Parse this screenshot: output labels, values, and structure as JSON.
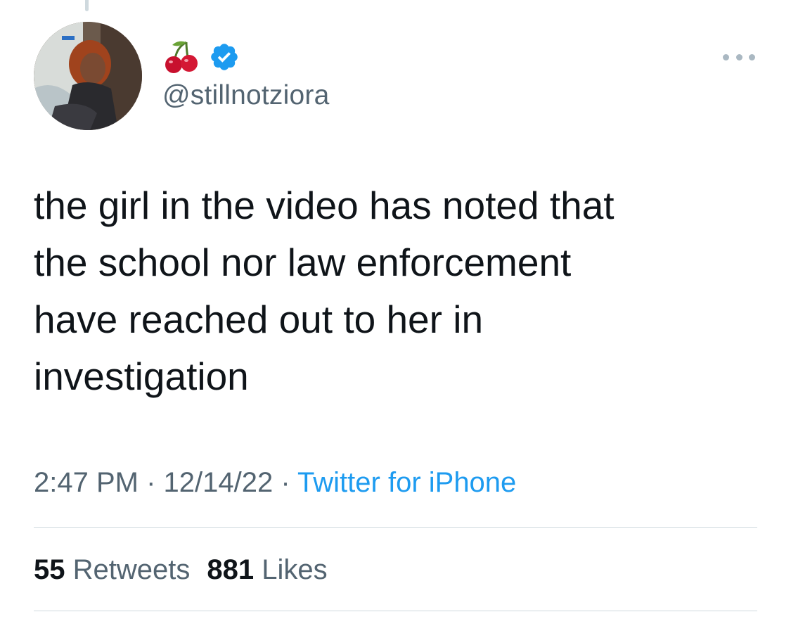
{
  "tweet": {
    "display_name_emoji": "cherry-icon",
    "verified_icon": "verified-badge-icon",
    "handle": "@stillnotziora",
    "text": "the girl in the video has noted that\nthe school nor law enforcement\nhave reached out to her in\ninvestigation",
    "time": "2:47 PM",
    "date": "12/14/22",
    "separator": " · ",
    "source": "Twitter for iPhone",
    "retweets_count": "55",
    "retweets_label": "Retweets",
    "likes_count": "881",
    "likes_label": "Likes"
  },
  "colors": {
    "accent": "#1d9bf0",
    "verified": "#1d9bf0",
    "secondary_text": "#536471",
    "primary_text": "#0f1419",
    "divider": "#cfd9de"
  }
}
